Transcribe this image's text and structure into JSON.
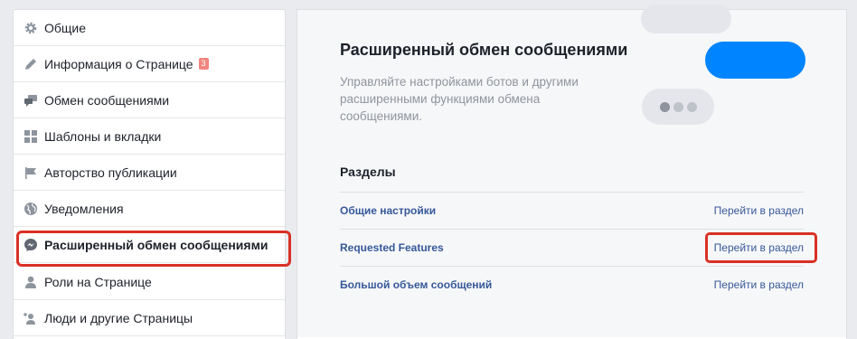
{
  "sidebar": {
    "items": [
      {
        "label": "Общие",
        "icon": "gear-icon"
      },
      {
        "label": "Информация о Странице",
        "icon": "pencil-icon",
        "badge": "3"
      },
      {
        "label": "Обмен сообщениями",
        "icon": "chat-bubbles-icon"
      },
      {
        "label": "Шаблоны и вкладки",
        "icon": "grid-icon"
      },
      {
        "label": "Авторство публикации",
        "icon": "flag-icon"
      },
      {
        "label": "Уведомления",
        "icon": "globe-icon"
      },
      {
        "label": "Расширенный обмен сообщениями",
        "icon": "messenger-icon",
        "active": true
      },
      {
        "label": "Роли на Странице",
        "icon": "person-icon"
      },
      {
        "label": "Люди и другие Страницы",
        "icon": "person-add-icon"
      }
    ]
  },
  "main": {
    "title": "Расширенный обмен сообщениями",
    "description": "Управляйте настройками ботов и другими расширенными функциями обмена сообщениями.",
    "sections_heading": "Разделы",
    "rows": [
      {
        "name": "Общие настройки",
        "action": "Перейти в раздел"
      },
      {
        "name": "Requested Features",
        "action": "Перейти в раздел"
      },
      {
        "name": "Большой объем сообщений",
        "action": "Перейти в раздел"
      }
    ]
  },
  "colors": {
    "accent_blue": "#0084ff",
    "link": "#365899",
    "highlight_red": "#d93025",
    "badge": "#f0857e"
  }
}
